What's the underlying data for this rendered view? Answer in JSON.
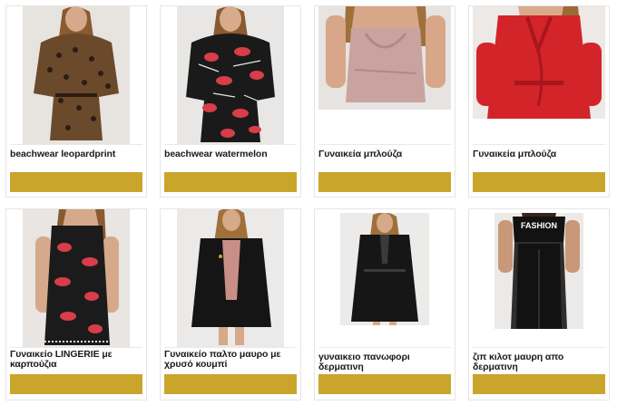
{
  "products": [
    {
      "title": "beachwear leopardprint",
      "colors": {
        "bg": "#e7e3df",
        "main": "#6b4a2c",
        "accent": "#2b1d14",
        "skin": "#d6a98a",
        "hair": "#8a5a30"
      },
      "pattern": "leopard-print"
    },
    {
      "title": "beachwear watermelon",
      "colors": {
        "bg": "#e9e7e5",
        "main": "#1a1a1a",
        "accent": "#d83d4a",
        "skin": "#d9ab8d",
        "hair": "#8a5a30"
      },
      "pattern": "watermelon-print"
    },
    {
      "title": "Γυναικεία μπλούζα",
      "colors": {
        "bg": "#e6e3e1",
        "main": "#c9a3a0",
        "accent": "#b08a86",
        "skin": "#d8a688",
        "hair": "#a0703a"
      },
      "pattern": "satin-top"
    },
    {
      "title": "Γυναικεία μπλούζα",
      "colors": {
        "bg": "#ece9e7",
        "main": "#d3242a",
        "accent": "#a9161d",
        "skin": "#d9ab8d",
        "hair": "#9b6a35"
      },
      "pattern": "ruffle-blouse"
    },
    {
      "title": "Γυναικείο LINGERIE με καρπούζια",
      "colors": {
        "bg": "#e8e5e2",
        "main": "#1b1b1b",
        "accent": "#d83d4a",
        "skin": "#d6a98a",
        "hair": "#8a5a30"
      },
      "pattern": "watermelon-print"
    },
    {
      "title": "Γυναικείο παλτο μαυρο με χρυσό κουμπί",
      "colors": {
        "bg": "#eceae8",
        "main": "#151515",
        "accent": "#c98f86",
        "skin": "#d6a98a",
        "hair": "#a0703a"
      },
      "pattern": "black-coat"
    },
    {
      "title": "γυναικειο πανωφορι δερματινη",
      "colors": {
        "bg": "#ecebea",
        "main": "#161616",
        "accent": "#3a3a3a",
        "skin": "#d6a98a",
        "hair": "#a0703a"
      },
      "pattern": "leather-coat"
    },
    {
      "title": "ζιπ κιλοτ μαυρη απο δερματινη",
      "colors": {
        "bg": "#eceae8",
        "main": "#121212",
        "accent": "#2e2e2e",
        "skin": "#c89878",
        "hair": "#3a2418"
      },
      "pattern": "fashion-jumpsuit",
      "shirt_text": "FASHION"
    }
  ]
}
